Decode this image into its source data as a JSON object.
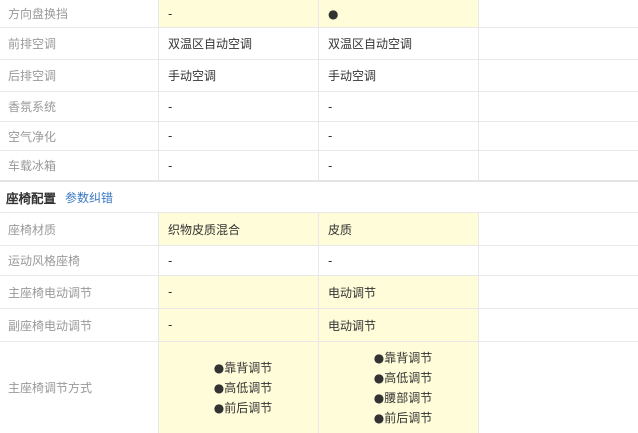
{
  "rows_top": [
    {
      "label": "方向盘换挡",
      "col1": "-",
      "col2": "●",
      "col1_hl": true,
      "col2_hl": true
    },
    {
      "label": "前排空调",
      "col1": "双温区自动空调",
      "col2": "双温区自动空调",
      "col1_hl": false,
      "col2_hl": false
    },
    {
      "label": "后排空调",
      "col1": "手动空调",
      "col2": "手动空调",
      "col1_hl": false,
      "col2_hl": false
    },
    {
      "label": "香氛系统",
      "col1": "-",
      "col2": "-",
      "col1_hl": false,
      "col2_hl": false
    },
    {
      "label": "空气净化",
      "col1": "-",
      "col2": "-",
      "col1_hl": false,
      "col2_hl": false
    },
    {
      "label": "车载冰箱",
      "col1": "-",
      "col2": "-",
      "col1_hl": false,
      "col2_hl": false
    }
  ],
  "section": {
    "title": "座椅配置",
    "link": "参数纠错"
  },
  "rows_seat": [
    {
      "label": "座椅材质",
      "col1": "织物皮质混合",
      "col2": "皮质",
      "col1_hl": true,
      "col2_hl": true
    },
    {
      "label": "运动风格座椅",
      "col1": "-",
      "col2": "-",
      "col1_hl": false,
      "col2_hl": false
    },
    {
      "label": "主座椅电动调节",
      "col1": "-",
      "col2": "电动调节",
      "col1_hl": true,
      "col2_hl": true
    },
    {
      "label": "副座椅电动调节",
      "col1": "-",
      "col2": "电动调节",
      "col1_hl": true,
      "col2_hl": true
    }
  ],
  "adjust_row": {
    "label": "主座椅调节方式",
    "col1": [
      "●靠背调节",
      "●高低调节",
      "●前后调节"
    ],
    "col2": [
      "●靠背调节",
      "●高低调节",
      "●腰部调节",
      "●前后调节"
    ]
  },
  "colors": {
    "highlight": "#fffdd9",
    "link": "#3a78c3",
    "label": "#999999"
  }
}
